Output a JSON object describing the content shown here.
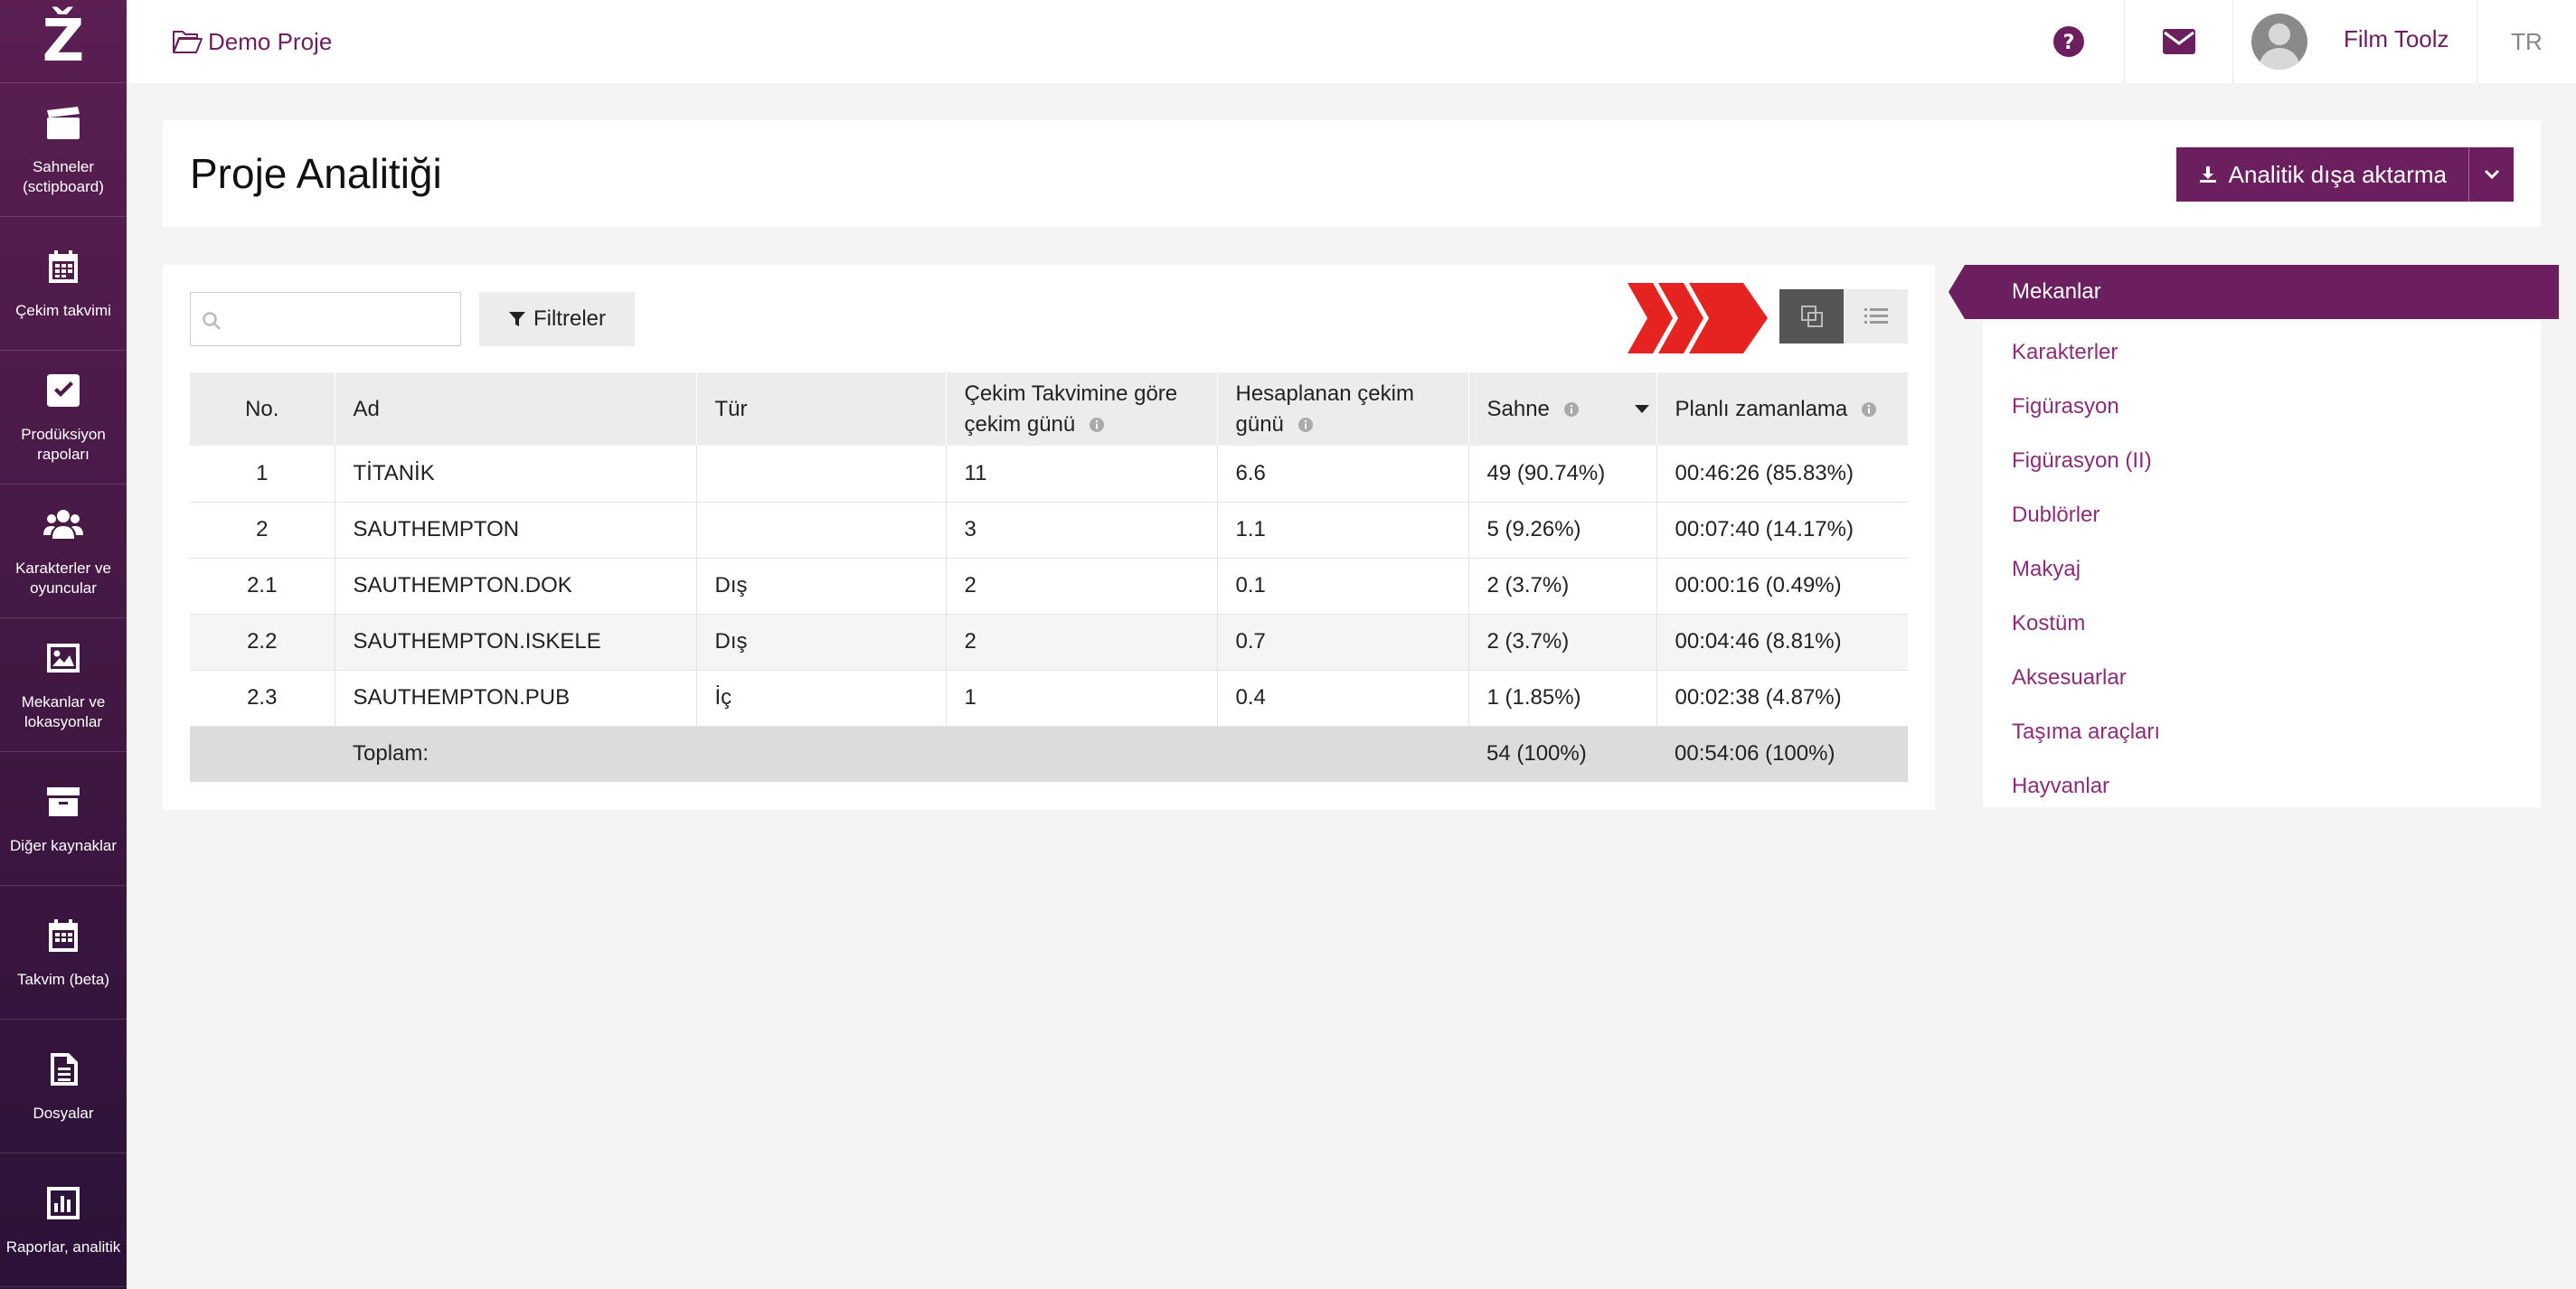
{
  "app": {
    "logo": "Ž"
  },
  "sidebar": {
    "items": [
      {
        "label": "Sahneler (sctipboard)",
        "icon": "clapperboard-icon"
      },
      {
        "label": "Çekim takvimi",
        "icon": "calendar-icon"
      },
      {
        "label": "Prodüksiyon rapoları",
        "icon": "checkbox-icon"
      },
      {
        "label": "Karakterler ve oyuncular",
        "icon": "users-icon"
      },
      {
        "label": "Mekanlar ve lokasyonlar",
        "icon": "image-icon"
      },
      {
        "label": "Diğer kaynaklar",
        "icon": "archive-icon"
      },
      {
        "label": "Takvim (beta)",
        "icon": "calendar-icon"
      },
      {
        "label": "Dosyalar",
        "icon": "file-icon"
      },
      {
        "label": "Raporlar, analitik",
        "icon": "bar-chart-icon"
      }
    ]
  },
  "topbar": {
    "project": "Demo Proje",
    "user": "Film Toolz",
    "lang": "TR",
    "help_icon": "question-circle-icon",
    "mail_icon": "envelope-icon"
  },
  "header": {
    "title": "Proje Analitiği",
    "export_label": "Analitik dışa aktarma"
  },
  "toolbar": {
    "search_placeholder": "",
    "filter_label": "Filtreler"
  },
  "table": {
    "headers": {
      "no": "No.",
      "ad": "Ad",
      "tur": "Tür",
      "cekim_line1": "Çekim Takvimine göre",
      "cekim_line2": "çekim günü",
      "hesap_line1": "Hesaplanan çekim",
      "hesap_line2": "günü",
      "sahne": "Sahne",
      "planli": "Planlı zamanlama"
    },
    "rows": [
      {
        "no": "1",
        "ad": "TİTANİK",
        "tur": "",
        "cekim": "11",
        "hesap": "6.6",
        "sahne": "49 (90.74%)",
        "planli": "00:46:26 (85.83%)"
      },
      {
        "no": "2",
        "ad": "SAUTHEMPTON",
        "tur": "",
        "cekim": "3",
        "hesap": "1.1",
        "sahne": "5 (9.26%)",
        "planli": "00:07:40 (14.17%)"
      },
      {
        "no": "2.1",
        "ad": "SAUTHEMPTON.DOK",
        "tur": "Dış",
        "cekim": "2",
        "hesap": "0.1",
        "sahne": "2 (3.7%)",
        "planli": "00:00:16 (0.49%)"
      },
      {
        "no": "2.2",
        "ad": "SAUTHEMPTON.ISKELE",
        "tur": "Dış",
        "cekim": "2",
        "hesap": "0.7",
        "sahne": "2 (3.7%)",
        "planli": "00:04:46 (8.81%)"
      },
      {
        "no": "2.3",
        "ad": "SAUTHEMPTON.PUB",
        "tur": "İç",
        "cekim": "1",
        "hesap": "0.4",
        "sahne": "1 (1.85%)",
        "planli": "00:02:38 (4.87%)"
      }
    ],
    "total": {
      "label": "Toplam:",
      "sahne": "54 (100%)",
      "planli": "00:54:06 (100%)"
    }
  },
  "categories": {
    "active": "Mekanlar",
    "items": [
      "Karakterler",
      "Figürasyon",
      "Figürasyon (II)",
      "Dublörler",
      "Makyaj",
      "Kostüm",
      "Aksesuarlar",
      "Taşıma araçları",
      "Hayvanlar"
    ]
  },
  "colors": {
    "brand": "#6b1f5e",
    "link": "#8b2d78",
    "arrow": "#e52421"
  }
}
